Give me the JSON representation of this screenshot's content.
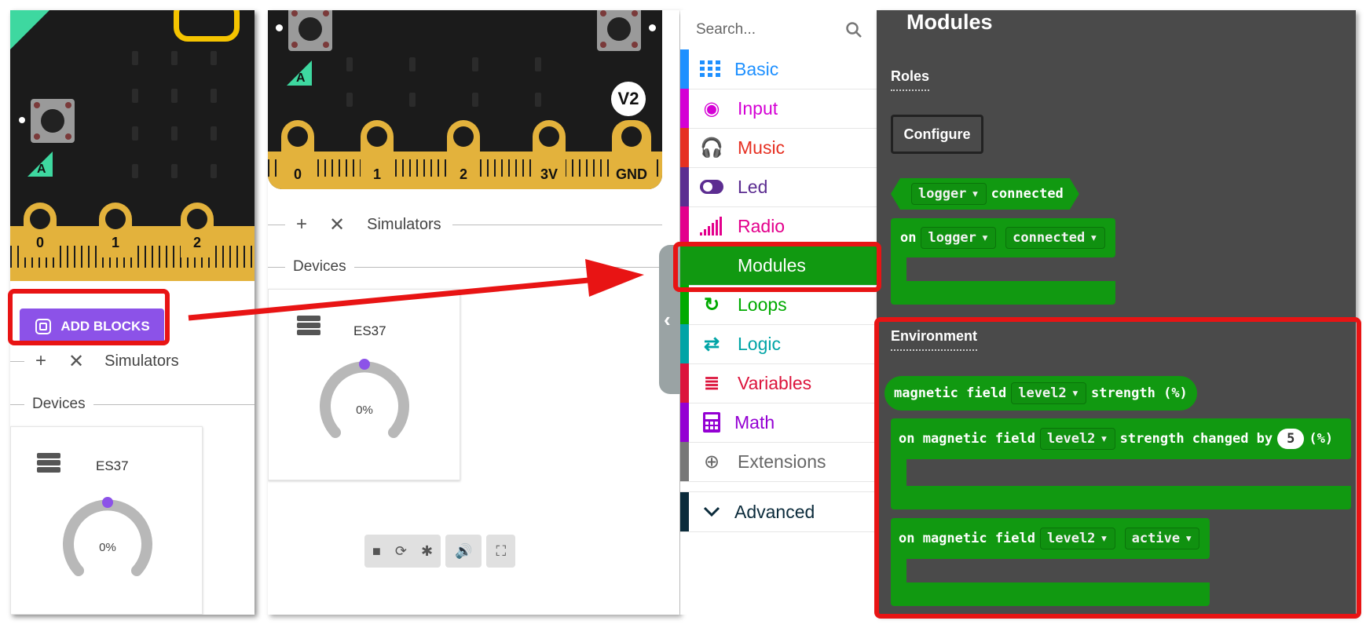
{
  "left_sim": {
    "pins": [
      "0",
      "1",
      "2"
    ],
    "add_blocks_label": "ADD BLOCKS",
    "simulators_label": "Simulators",
    "devices_label": "Devices",
    "device_name": "ES37",
    "gauge_value": "0%",
    "gauge_fraction": 0
  },
  "mid_sim": {
    "pins": [
      "0",
      "1",
      "2",
      "3V",
      "GND"
    ],
    "version_badge": "V2",
    "simulators_label": "Simulators",
    "devices_label": "Devices",
    "device_name": "ES37",
    "gauge_value": "0%",
    "gauge_fraction": 0,
    "controls": [
      "stop-icon",
      "restart-icon",
      "debug-icon",
      "sound-icon",
      "fullscreen-icon"
    ]
  },
  "toolbox": {
    "search_placeholder": "Search...",
    "categories": [
      {
        "label": "Basic",
        "color": "#1e90ff",
        "icon": "grid-icon"
      },
      {
        "label": "Input",
        "color": "#d400d4",
        "icon": "target-icon"
      },
      {
        "label": "Music",
        "color": "#e63022",
        "icon": "headphones-icon"
      },
      {
        "label": "Led",
        "color": "#5c2d91",
        "icon": "toggle-icon"
      },
      {
        "label": "Radio",
        "color": "#e3008c",
        "icon": "signal-icon"
      },
      {
        "label": "Modules",
        "color": "#119911",
        "icon": ""
      },
      {
        "label": "Loops",
        "color": "#00aa00",
        "icon": "loop-icon"
      },
      {
        "label": "Logic",
        "color": "#00a4a6",
        "icon": "shuffle-icon"
      },
      {
        "label": "Variables",
        "color": "#dc143c",
        "icon": "list-icon"
      },
      {
        "label": "Math",
        "color": "#9400d3",
        "icon": "calculator-icon"
      },
      {
        "label": "Extensions",
        "color": "#777777",
        "icon": "plus-circle-icon"
      },
      {
        "label": "Advanced",
        "color": "#0b2b3b",
        "icon": "chevron-down-icon"
      }
    ]
  },
  "flyout": {
    "title": "Modules",
    "roles_label": "Roles",
    "configure_label": "Configure",
    "b1": {
      "dd": "logger",
      "text": "connected"
    },
    "b2": {
      "on": "on",
      "dd1": "logger",
      "dd2": "connected"
    },
    "environment_label": "Environment",
    "b3": {
      "pre": "magnetic field",
      "dd": "level2",
      "post": "strength (%)"
    },
    "b4": {
      "pre": "on magnetic field",
      "dd": "level2",
      "mid": "strength changed by",
      "num": "5",
      "post": "(%)"
    },
    "b5": {
      "pre": "on magnetic field",
      "dd1": "level2",
      "dd2": "active"
    }
  }
}
